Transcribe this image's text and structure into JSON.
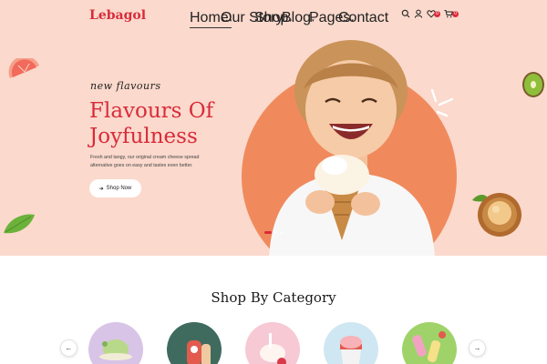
{
  "header": {
    "logo": "Lebagol",
    "nav": [
      {
        "label": "Home",
        "has_dropdown": true,
        "active": true
      },
      {
        "label": "Our Story",
        "has_dropdown": false,
        "active": false
      },
      {
        "label": "Shop",
        "has_dropdown": true,
        "active": false
      },
      {
        "label": "Blog",
        "has_dropdown": true,
        "active": false
      },
      {
        "label": "Pages",
        "has_dropdown": true,
        "active": false
      },
      {
        "label": "Contact",
        "has_dropdown": false,
        "active": false
      }
    ],
    "wishlist_count": "0",
    "cart_count": "0",
    "icons": [
      "search-icon",
      "user-icon",
      "heart-icon",
      "cart-icon"
    ]
  },
  "hero": {
    "script_text": "new flavours",
    "headline_line1": "Flavours Of",
    "headline_line2": "Joyfulness",
    "description": "Fresh and tangy, our original cream cheese spread alternative goes on easy and tastes even better.",
    "cta_label": "Shop Now",
    "slide_count": 3,
    "active_slide": 1
  },
  "categories": {
    "title": "Shop By Category",
    "item_count": 5
  },
  "colors": {
    "brand_red": "#d92b3a",
    "hero_bg": "#fbd9cc",
    "accent_orange": "#f08a5d"
  }
}
